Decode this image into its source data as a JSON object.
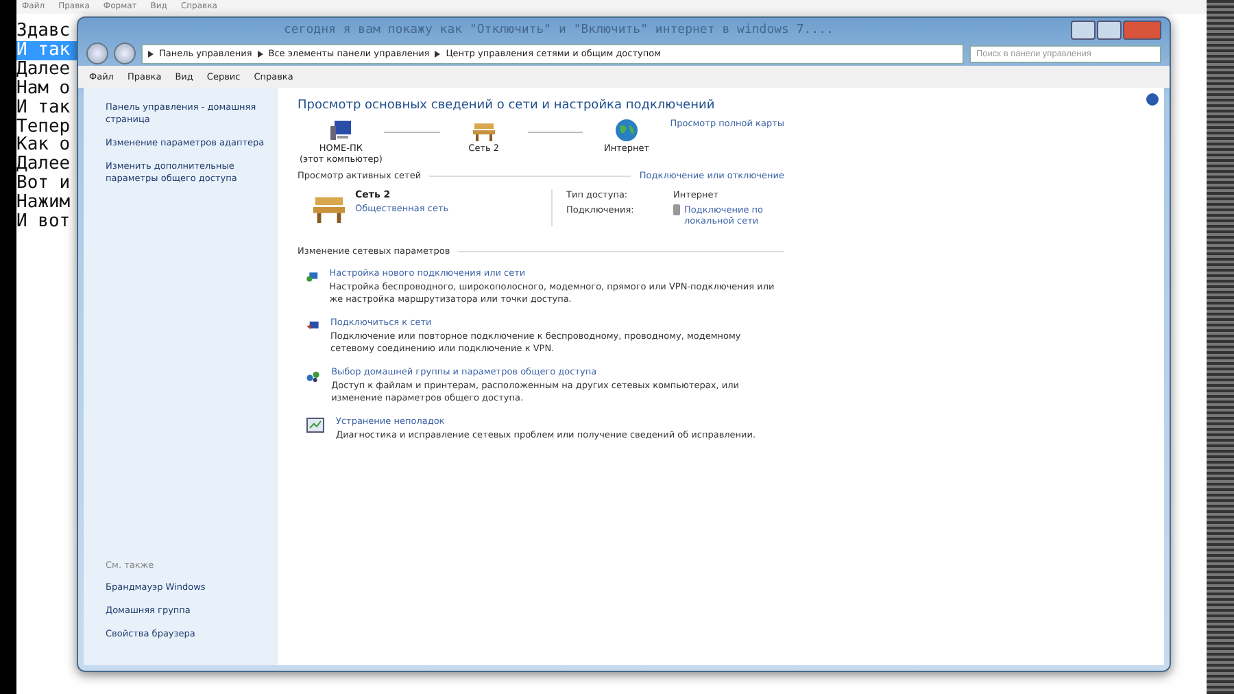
{
  "notepad": {
    "menu": [
      "Файл",
      "Правка",
      "Формат",
      "Вид",
      "Справка"
    ],
    "lines": [
      {
        "text": "Здавс",
        "selected": false
      },
      {
        "text": "И так",
        "selected": true
      },
      {
        "text": "Далее",
        "selected": false
      },
      {
        "text": "Нам о",
        "selected": false
      },
      {
        "text": "И так",
        "selected": false
      },
      {
        "text": "Тепер",
        "selected": false
      },
      {
        "text": "Как о",
        "selected": false
      },
      {
        "text": "Далее",
        "selected": false
      },
      {
        "text": "Вот и",
        "selected": false
      },
      {
        "text": "Нажим",
        "selected": false
      },
      {
        "text": "И вот",
        "selected": false
      }
    ]
  },
  "window": {
    "glass_text": "сегодня я вам покажу как \"Отключить\" и \"Включить\" интернет в windows 7....",
    "breadcrumb": [
      "Панель управления",
      "Все элементы панели управления",
      "Центр управления сетями и общим доступом"
    ],
    "search": {
      "placeholder": "Поиск в панели управления"
    },
    "menu": [
      "Файл",
      "Правка",
      "Вид",
      "Сервис",
      "Справка"
    ],
    "sidebar": {
      "links": [
        "Панель управления - домашняя страница",
        "Изменение параметров адаптера",
        "Изменить дополнительные параметры общего доступа"
      ],
      "see_also_title": "См. также",
      "see_also": [
        "Брандмауэр Windows",
        "Домашняя группа",
        "Свойства браузера"
      ]
    },
    "main": {
      "heading": "Просмотр основных сведений о сети и настройка подключений",
      "map": {
        "nodes": [
          {
            "kind": "computer",
            "label": "HOME-ПК",
            "sublabel": "(этот компьютер)"
          },
          {
            "kind": "bench",
            "label": "Сеть 2"
          },
          {
            "kind": "globe",
            "label": "Интернет"
          }
        ],
        "full_map_link": "Просмотр полной карты"
      },
      "active": {
        "title": "Просмотр активных сетей",
        "connect_link": "Подключение или отключение",
        "network_name": "Сеть 2",
        "network_type": "Общественная сеть",
        "access_label": "Тип доступа:",
        "access_value": "Интернет",
        "connections_label": "Подключения:",
        "connections_value": "Подключение по локальной сети"
      },
      "change": {
        "title": "Изменение сетевых параметров",
        "tasks": [
          {
            "kind": "setup",
            "title": "Настройка нового подключения или сети",
            "description": "Настройка беспроводного, широкополосного, модемного, прямого или VPN-подключения или же настройка маршрутизатора или точки доступа."
          },
          {
            "kind": "connect",
            "title": "Подключиться к сети",
            "description": "Подключение или повторное подключение к беспроводному, проводному, модемному сетевому соединению или подключение к VPN."
          },
          {
            "kind": "homegroup",
            "title": "Выбор домашней группы и параметров общего доступа",
            "description": "Доступ к файлам и принтерам, расположенным на других сетевых компьютерах, или изменение параметров общего доступа."
          },
          {
            "kind": "troubleshoot",
            "title": "Устранение неполадок",
            "description": "Диагностика и исправление сетевых проблем или получение сведений об исправлении."
          }
        ]
      }
    }
  }
}
